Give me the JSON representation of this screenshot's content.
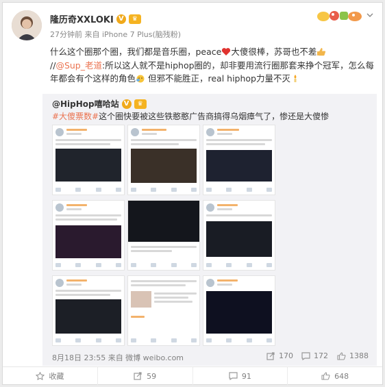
{
  "post": {
    "author": "隆历奇XXLOKI",
    "meta": "27分钟前 来自 iPhone 7 Plus(脑残粉)",
    "text_1": "什么这个圈那个圈，我们都是音乐圈，peace",
    "text_2": "大傻很棒，苏哥也不差",
    "text_3": "//",
    "mention": "@Sup_老道",
    "text_4": ":所以这人就不是hiphop圈的，却非要用流行圈那套来挣个冠军，怎么每年都会有个这样的角色",
    "text_5": " 但邪不能胜正，real hiphop力量不灭"
  },
  "repost": {
    "author": "@HipHop嘻哈站",
    "tag": "#大傻票数#",
    "text": "这个圈快要被这些铁憨憨广告商搞得乌烟瘴气了，惨还是大傻惨",
    "date": "8月18日 23:55 来自 微博 weibo.com",
    "reposts": "170",
    "comments": "172",
    "likes": "1388"
  },
  "actions": {
    "favorite": "收藏",
    "repost": "59",
    "comment": "91",
    "like": "648"
  },
  "colors": {
    "accent": "#eb7350",
    "gold": "#f0a91b",
    "muted": "#808080"
  }
}
